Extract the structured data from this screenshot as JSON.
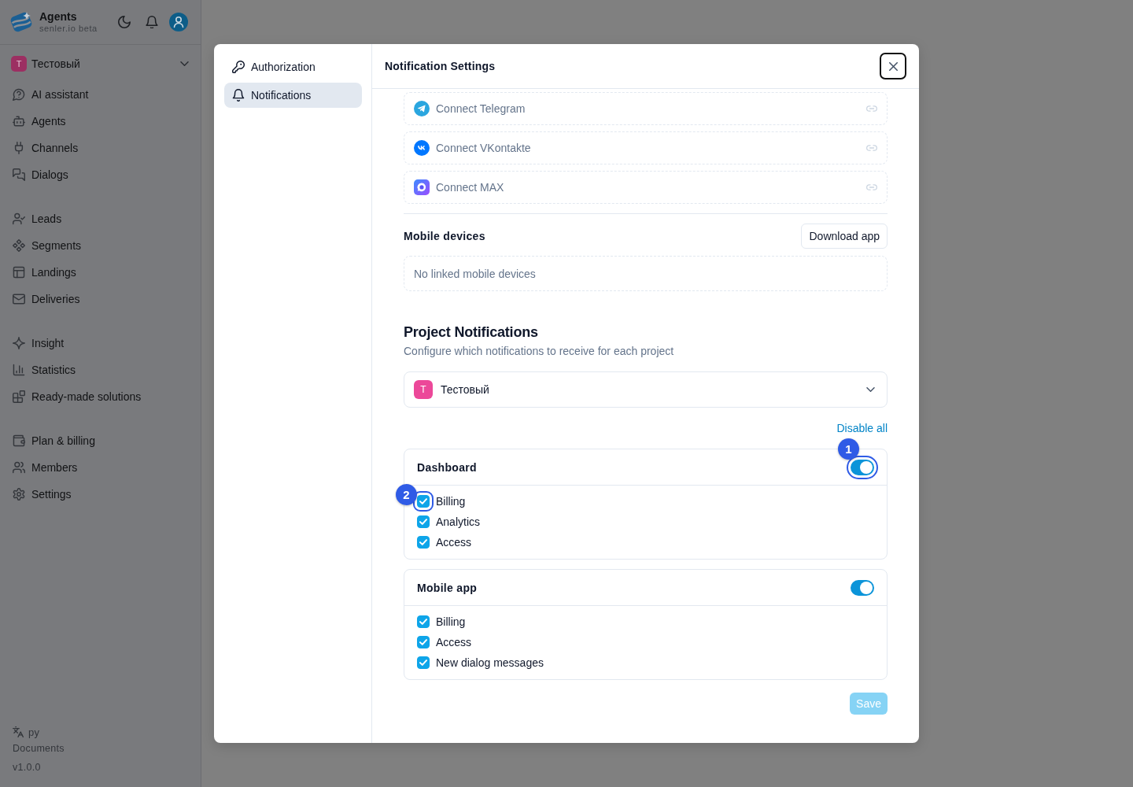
{
  "sidebar": {
    "brand": {
      "title": "Agents",
      "subtitle": "senler.io beta"
    },
    "project": {
      "initial": "T",
      "name": "Тестовый"
    },
    "nav_groups": [
      {
        "items": [
          {
            "label": "AI assistant",
            "selected": false
          },
          {
            "label": "Agents",
            "selected": false
          },
          {
            "label": "Channels",
            "selected": false
          },
          {
            "label": "Dialogs",
            "selected": false
          }
        ]
      },
      {
        "items": [
          {
            "label": "Leads",
            "selected": false
          },
          {
            "label": "Segments",
            "selected": false
          },
          {
            "label": "Landings",
            "selected": false
          },
          {
            "label": "Deliveries",
            "selected": false
          }
        ]
      },
      {
        "items": [
          {
            "label": "Insight",
            "selected": false
          },
          {
            "label": "Statistics",
            "selected": false
          },
          {
            "label": "Ready-made solutions",
            "selected": false
          }
        ]
      },
      {
        "items": [
          {
            "label": "Plan & billing",
            "selected": false
          },
          {
            "label": "Members",
            "selected": false
          },
          {
            "label": "Settings",
            "selected": false
          }
        ]
      }
    ],
    "footer": {
      "language": "ру",
      "documents": "Documents",
      "version": "v1.0.0"
    }
  },
  "modal": {
    "nav": [
      {
        "label": "Authorization",
        "selected": false
      },
      {
        "label": "Notifications",
        "selected": true
      }
    ],
    "title": "Notification Settings",
    "connect_rows": [
      {
        "label": "Connect Telegram"
      },
      {
        "label": "Connect VKontakte"
      },
      {
        "label": "Connect MAX"
      }
    ],
    "mobile_devices": {
      "title": "Mobile devices",
      "button": "Download app",
      "empty_text": "No linked mobile devices"
    },
    "project_notifications": {
      "title": "Project Notifications",
      "subtitle": "Configure which notifications to receive for each project",
      "project": {
        "initial": "T",
        "name": "Тестовый"
      },
      "disable_all": "Disable all",
      "groups": [
        {
          "title": "Dashboard",
          "on": true,
          "toggle_marker": "1",
          "items": [
            {
              "label": "Billing",
              "checked": true,
              "marker": "2"
            },
            {
              "label": "Analytics",
              "checked": true
            },
            {
              "label": "Access",
              "checked": true
            }
          ]
        },
        {
          "title": "Mobile app",
          "on": true,
          "items": [
            {
              "label": "Billing",
              "checked": true
            },
            {
              "label": "Access",
              "checked": true
            },
            {
              "label": "New dialog messages",
              "checked": true
            }
          ]
        }
      ]
    },
    "save_button": {
      "label": "Save",
      "disabled": true
    }
  }
}
